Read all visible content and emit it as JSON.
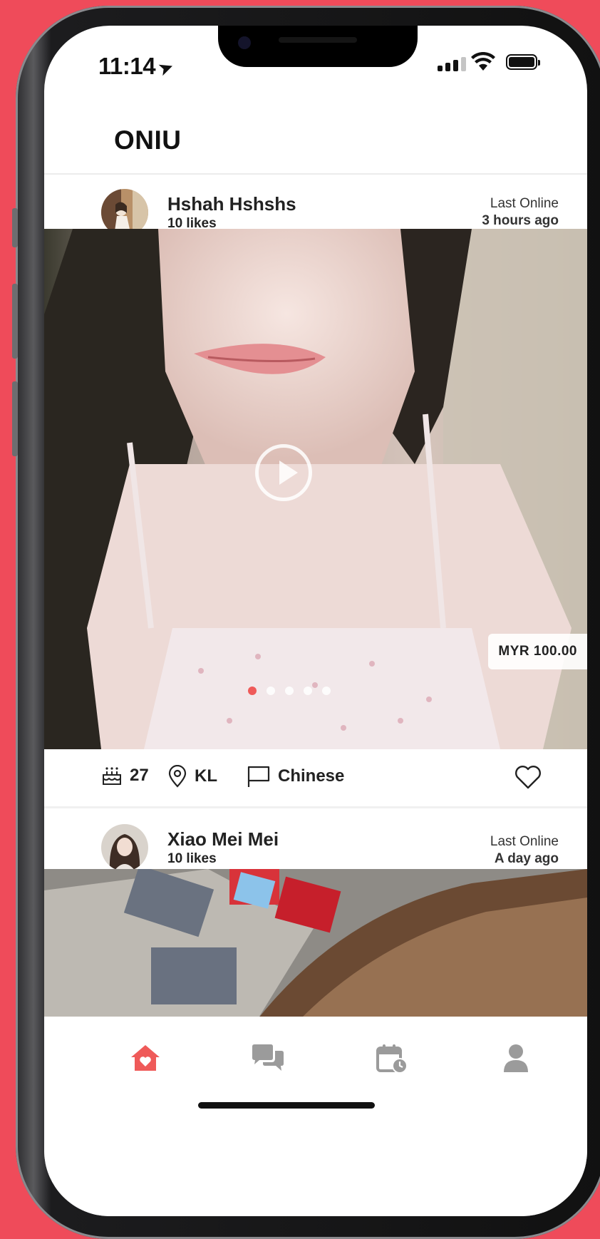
{
  "status_bar": {
    "time": "11:14",
    "location_arrow": "➤"
  },
  "app": {
    "title": "ONIU"
  },
  "posts": [
    {
      "name": "Hshah Hshshs",
      "likes": "10 likes",
      "last_online_label": "Last Online",
      "last_online_value": "3 hours ago",
      "price": "MYR 100.00",
      "age": "27",
      "location": "KL",
      "language": "Chinese",
      "carousel": {
        "count": 5,
        "active_index": 0
      }
    },
    {
      "name": "Xiao Mei Mei",
      "likes": "10 likes",
      "last_online_label": "Last Online",
      "last_online_value": "A day ago"
    }
  ],
  "bottom_nav": {
    "items": [
      "home-heart-icon",
      "chat-bubbles-icon",
      "calendar-clock-icon",
      "profile-icon"
    ],
    "active": "home-heart-icon",
    "accent_color": "#ef5a59"
  },
  "colors": {
    "background": "#ef4b5a",
    "accent": "#ef5a59"
  }
}
